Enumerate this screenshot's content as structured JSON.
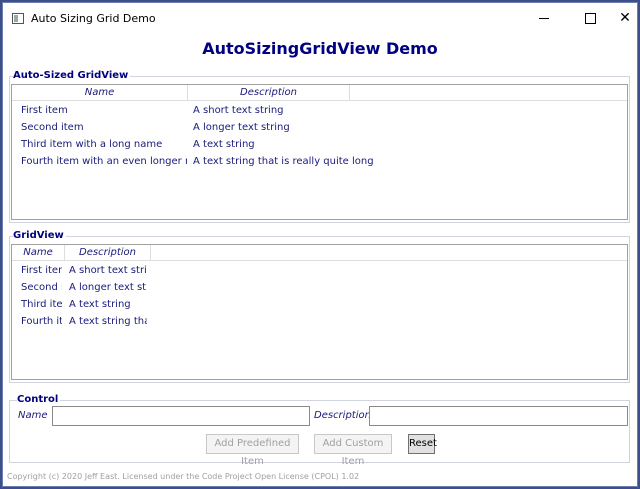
{
  "window": {
    "title": "Auto Sizing Grid Demo"
  },
  "heading": "AutoSizingGridView Demo",
  "auto_sized": {
    "group_title": "Auto-Sized GridView",
    "columns": [
      "Name",
      "Description"
    ],
    "rows": [
      {
        "name": "First item",
        "description": "A short text string"
      },
      {
        "name": "Second item",
        "description": "A longer text string"
      },
      {
        "name": "Third item with a long name",
        "description": "A text string"
      },
      {
        "name": "Fourth item with an even longer name",
        "description": "A text string that is really quite long"
      }
    ]
  },
  "gridview": {
    "group_title": "GridView",
    "columns": [
      "Name",
      "Description"
    ],
    "rows": [
      {
        "name": "First item",
        "description": "A short text string"
      },
      {
        "name": "Second it",
        "description": "A longer text strin"
      },
      {
        "name": "Third item",
        "description": "A text string"
      },
      {
        "name": "Fourth ite",
        "description": "A text string that i"
      }
    ]
  },
  "control": {
    "group_title": "Control",
    "name_label": "Name",
    "name_value": "",
    "description_label": "Description",
    "description_value": "",
    "add_predefined_label": "Add Predefined Item",
    "add_custom_label": "Add Custom Item",
    "reset_label": "Reset"
  },
  "copyright": "Copyright (c) 2020 Jeff East. Licensed under the Code Project Open License (CPOL) 1.02"
}
